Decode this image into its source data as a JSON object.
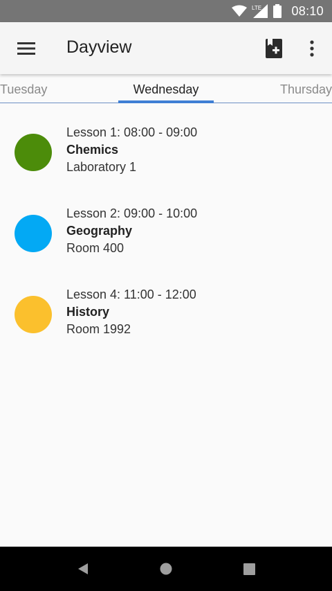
{
  "status_bar": {
    "time": "08:10",
    "network_label": "LTE",
    "icons": [
      "wifi-icon",
      "lte-signal-icon",
      "battery-icon"
    ]
  },
  "app_bar": {
    "title": "Dayview",
    "icons": [
      "menu-icon",
      "add-lesson-icon",
      "more-vert-icon"
    ]
  },
  "tabs": {
    "previous": "Tuesday",
    "active": "Wednesday",
    "next": "Thursday",
    "indicator_color": "#3f7fd4"
  },
  "lessons": [
    {
      "time": "Lesson 1: 08:00 - 09:00",
      "subject": "Chemics",
      "room": "Laboratory 1",
      "color": "#4c8c0a"
    },
    {
      "time": "Lesson 2: 09:00 - 10:00",
      "subject": "Geography",
      "room": "Room 400",
      "color": "#03a9f4"
    },
    {
      "time": "Lesson 4: 11:00 - 12:00",
      "subject": "History",
      "room": "Room 1992",
      "color": "#fbc02d"
    }
  ],
  "nav_bar": {
    "icons": [
      "back-icon",
      "home-icon",
      "recents-icon"
    ]
  }
}
